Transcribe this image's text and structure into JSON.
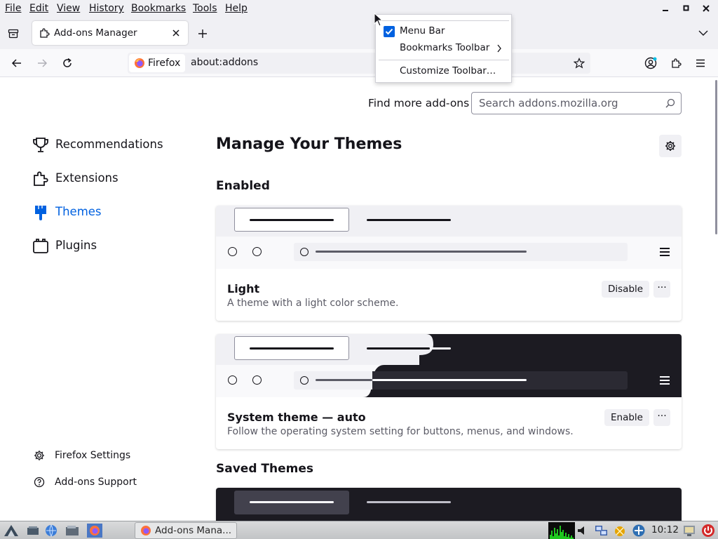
{
  "menubar": {
    "items": [
      {
        "label": "File"
      },
      {
        "label": "Edit"
      },
      {
        "label": "View"
      },
      {
        "label": "History"
      },
      {
        "label": "Bookmarks"
      },
      {
        "label": "Tools"
      },
      {
        "label": "Help"
      }
    ]
  },
  "tabs": {
    "active_title": "Add-ons Manager"
  },
  "navbar": {
    "identity_label": "Firefox",
    "url": "about:addons"
  },
  "context_menu": {
    "items": [
      {
        "label": "Menu Bar",
        "checked": true
      },
      {
        "label": "Bookmarks Toolbar",
        "has_submenu": true
      },
      {
        "label": "Customize Toolbar…"
      }
    ]
  },
  "addons": {
    "find_more_label": "Find more add-ons",
    "search_placeholder": "Search addons.mozilla.org",
    "categories": [
      {
        "label": "Recommendations",
        "icon": "trophy-icon"
      },
      {
        "label": "Extensions",
        "icon": "puzzle-icon"
      },
      {
        "label": "Themes",
        "icon": "brush-icon",
        "active": true
      },
      {
        "label": "Plugins",
        "icon": "plugin-icon"
      }
    ],
    "footer_links": [
      {
        "label": "Firefox Settings",
        "icon": "gear-icon"
      },
      {
        "label": "Add-ons Support",
        "icon": "help-icon"
      }
    ],
    "page_title": "Manage Your Themes",
    "enabled_heading": "Enabled",
    "saved_heading": "Saved Themes",
    "themes": [
      {
        "name": "Light",
        "description": "A theme with a light color scheme.",
        "action": "Disable",
        "more": "···"
      },
      {
        "name": "System theme — auto",
        "description": "Follow the operating system setting for buttons, menus, and windows.",
        "action": "Enable",
        "more": "···"
      }
    ]
  },
  "taskbar": {
    "task_label": "Add-ons Mana...",
    "clock": "10:12"
  },
  "colors": {
    "accent": "#0061e0",
    "chrome_bg": "#f0f0f4",
    "dark_theme": "#1c1b22"
  }
}
